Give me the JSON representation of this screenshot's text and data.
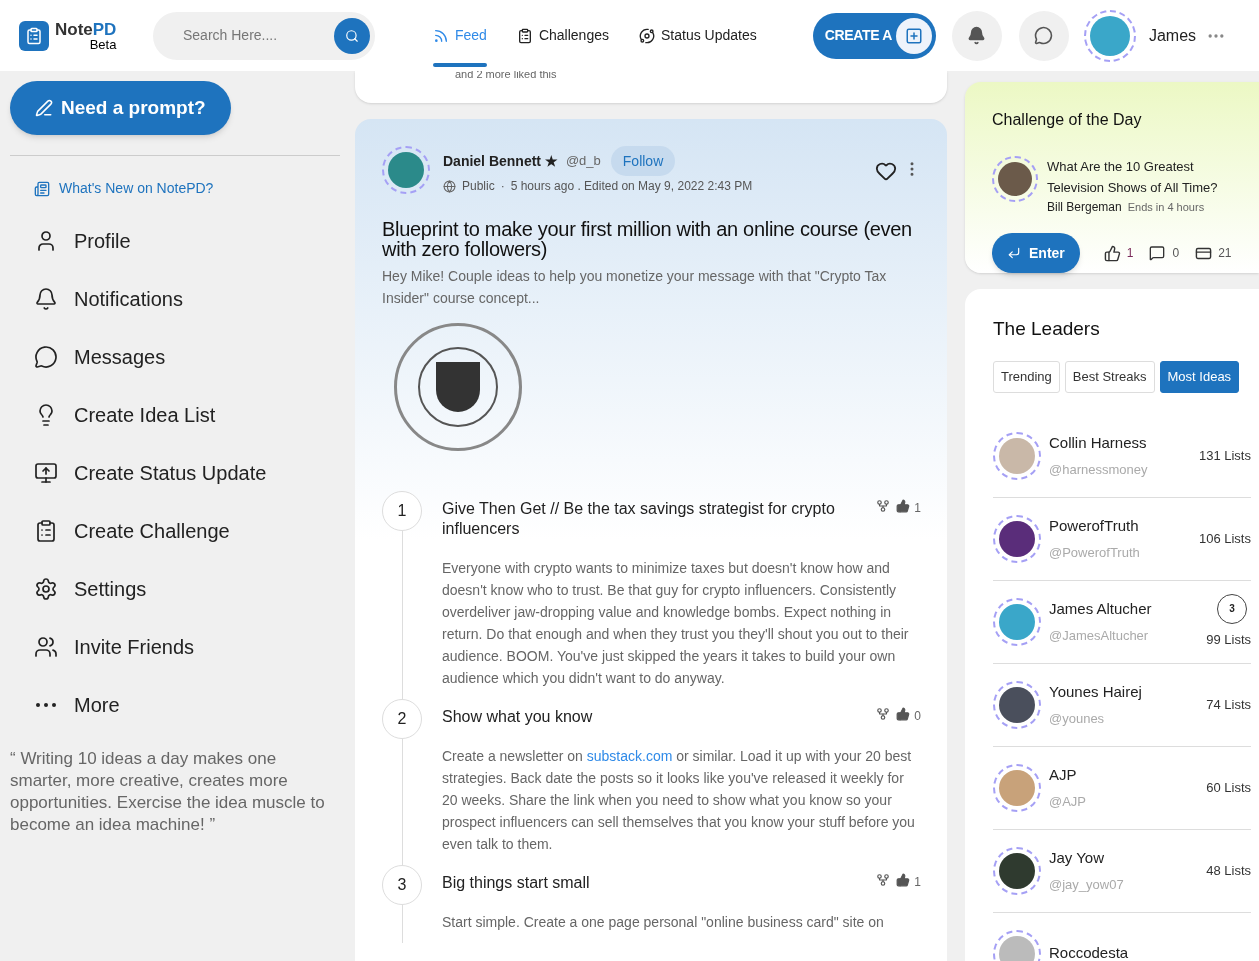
{
  "header": {
    "logo": {
      "first": "Note",
      "second": "PD",
      "sub": "Beta"
    },
    "search": {
      "placeholder": "Search Here...."
    },
    "nav": [
      {
        "label": "Feed",
        "selected": true
      },
      {
        "label": "Challenges",
        "selected": false
      },
      {
        "label": "Status Updates",
        "selected": false
      }
    ],
    "create_button": "CREATE A",
    "user_name": "James"
  },
  "sidebar": {
    "prompt_button": "Need a prompt?",
    "whats_new": "What's New on NotePD?",
    "items": [
      {
        "label": "Profile"
      },
      {
        "label": "Notifications"
      },
      {
        "label": "Messages"
      },
      {
        "label": "Create Idea List"
      },
      {
        "label": "Create Status Update"
      },
      {
        "label": "Create Challenge"
      },
      {
        "label": "Settings"
      },
      {
        "label": "Invite Friends"
      },
      {
        "label": "More"
      }
    ],
    "quote": "“ Writing 10 ideas a day makes one smarter, more creative, creates more opportunities. Exercise the idea muscle to become an idea machine! ”"
  },
  "feed": {
    "previous_card": {
      "likes_text": "and 2 more liked this"
    },
    "post": {
      "author": "Daniel Bennett ★",
      "handle": "@d_b",
      "follow": "Follow",
      "visibility": "Public",
      "separator": "·",
      "time": "5 hours ago . Edited on May 9, 2022 2:43 PM",
      "liked": false,
      "title": "Blueprint to make your first million with an online course (even with zero followers)",
      "excerpt": "Hey Mike! Couple ideas to help you monetize your message with that \"Crypto Tax Insider\" course concept...",
      "ideas": [
        {
          "number": "1",
          "title": "Give Then Get // Be the tax savings strategist for crypto influencers",
          "likes": "1",
          "body": [
            {
              "text": "Everyone with crypto wants to minimize taxes but doesn't know how and doesn't know who to trust. Be that guy for crypto influencers. Consistently overdeliver jaw-dropping value and knowledge bombs. Expect nothing in return. Do that enough and when they trust you they'll shout you out to their audience. BOOM. You've just skipped the years it takes to build your own audience which you didn't want to do anyway.",
              "kind": "text"
            }
          ]
        },
        {
          "number": "2",
          "title": "Show what you know",
          "likes": "0",
          "body": [
            {
              "text": "Create a newsletter on ",
              "kind": "text"
            },
            {
              "text": "substack.com",
              "kind": "link"
            },
            {
              "text": " or similar. Load it up with your 20 best strategies. Back date the posts so it looks like you've released it weekly for 20 weeks. Share the link when you need to show what you know so your prospect influencers can sell themselves that you know your stuff before you even talk to them.",
              "kind": "text"
            }
          ]
        },
        {
          "number": "3",
          "title": "Big things start small",
          "likes": "1",
          "body": [
            {
              "text": "Start simple. Create a one page personal \"online business card\" site on",
              "kind": "text"
            }
          ]
        }
      ]
    }
  },
  "challenge": {
    "heading": "Challenge of the Day",
    "title": "What Are the 10 Greatest Television Shows of All Time?",
    "author": "Bill Bergeman",
    "ends": "Ends in 4 hours",
    "enter": "Enter",
    "likes": "1",
    "comments": "0",
    "entries": "21"
  },
  "leaders": {
    "heading": "The Leaders",
    "tabs": [
      {
        "label": "Trending",
        "selected": false
      },
      {
        "label": "Best Streaks",
        "selected": false
      },
      {
        "label": "Most Ideas",
        "selected": true
      }
    ],
    "rows": [
      {
        "name": "Collin Harness",
        "handle": "@harnessmoney",
        "count": "131 Lists"
      },
      {
        "name": "PowerofTruth",
        "handle": "@PowerofTruth",
        "count": "106 Lists"
      },
      {
        "name": "James Altucher",
        "handle": "@JamesAltucher",
        "count": "99 Lists",
        "badge": "3"
      },
      {
        "name": "Younes Hairej",
        "handle": "@younes",
        "count": "74 Lists"
      },
      {
        "name": "AJP",
        "handle": "@AJP",
        "count": "60 Lists"
      },
      {
        "name": "Jay Yow",
        "handle": "@jay_yow07",
        "count": "48 Lists"
      },
      {
        "name": "Roccodesta"
      }
    ]
  }
}
